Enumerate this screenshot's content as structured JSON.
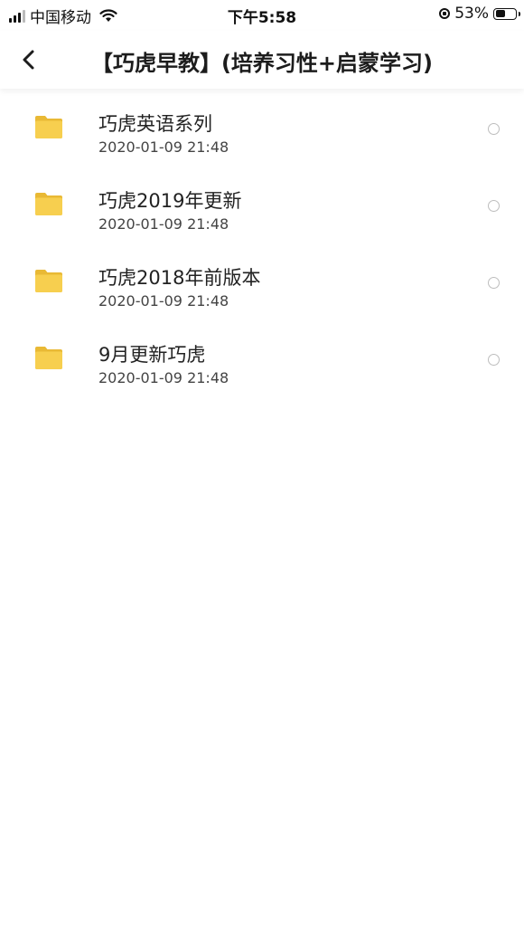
{
  "status_bar": {
    "carrier": "中国移动",
    "time": "下午5:58",
    "battery_percent": "53%",
    "battery_level": 0.53,
    "icons": [
      "signal-icon",
      "wifi-icon",
      "orientation-lock-icon",
      "battery-icon"
    ]
  },
  "header": {
    "title": "【巧虎早教】(培养习性+启蒙学习)",
    "back_icon": "chevron-left-icon"
  },
  "colors": {
    "folder": "#f7cf4f",
    "folder_dark": "#e9b935",
    "radio_border": "#bdbdbd"
  },
  "files": [
    {
      "name": "巧虎英语系列",
      "date": "2020-01-09 21:48",
      "icon": "folder-icon"
    },
    {
      "name": "巧虎2019年更新",
      "date": "2020-01-09 21:48",
      "icon": "folder-icon"
    },
    {
      "name": "巧虎2018年前版本",
      "date": "2020-01-09 21:48",
      "icon": "folder-icon"
    },
    {
      "name": "9月更新巧虎",
      "date": "2020-01-09 21:48",
      "icon": "folder-icon"
    }
  ]
}
